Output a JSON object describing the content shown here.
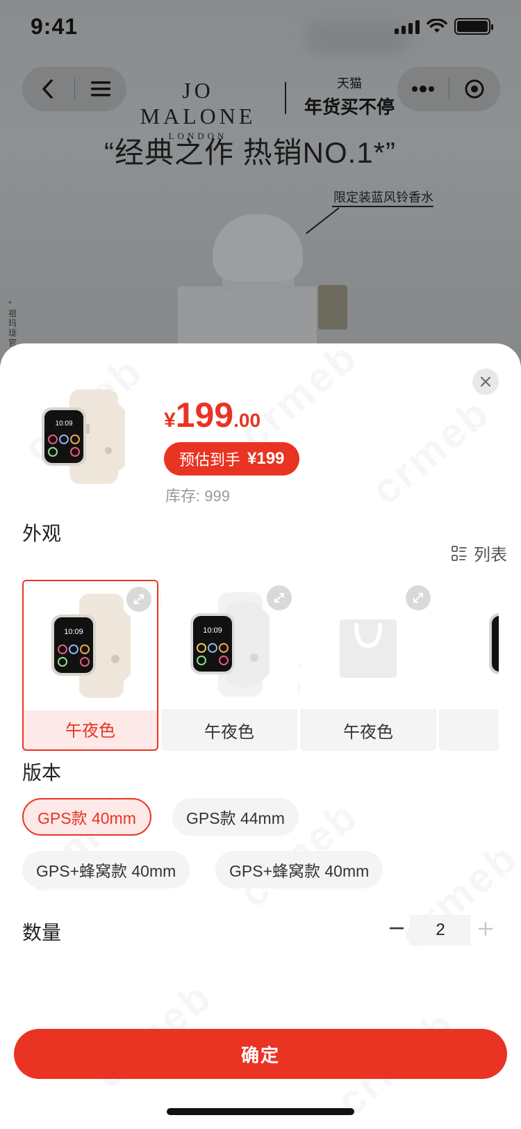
{
  "status_bar": {
    "time": "9:41"
  },
  "background_page": {
    "brand_name": "JO MALONE",
    "brand_sub": "LONDON",
    "promo_top": "天猫",
    "promo_main": "年货买不停",
    "headline": "“经典之作 热销NO.1*”",
    "callout": "限定装蓝风铃香水",
    "side_note": "*祖玛珑官方"
  },
  "product": {
    "price_symbol": "¥",
    "price_integer": "199",
    "price_decimal": ".00",
    "estimate_label": "预估到手",
    "estimate_amount": "¥199",
    "stock": "库存: 999"
  },
  "appearance": {
    "title": "外观",
    "list_toggle_label": "列表",
    "options": [
      {
        "label": "午夜色",
        "selected": true,
        "image": "watch-icon"
      },
      {
        "label": "午夜色",
        "selected": false,
        "image": "watch-icon"
      },
      {
        "label": "午夜色",
        "selected": false,
        "image": "bag-placeholder-icon"
      }
    ]
  },
  "version": {
    "title": "版本",
    "options": [
      {
        "label": "GPS款 40mm",
        "selected": true
      },
      {
        "label": "GPS款 44mm",
        "selected": false
      },
      {
        "label": "GPS+蜂窝款 40mm",
        "selected": false
      },
      {
        "label": "GPS+蜂窝款 40mm",
        "selected": false
      }
    ]
  },
  "quantity": {
    "title": "数量",
    "value": "2"
  },
  "confirm_label": "确定",
  "watermark_text": "crmeb",
  "colors": {
    "accent": "#e93323",
    "accent_light": "#fde9e7",
    "chip_bg": "#f4f4f4"
  }
}
